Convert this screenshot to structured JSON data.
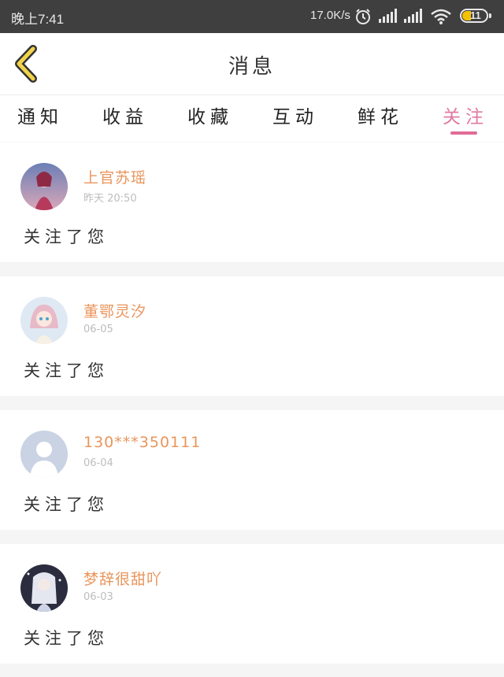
{
  "status_bar": {
    "time": "晚上7:41",
    "network_speed": "17.0K/s",
    "battery": "11",
    "icons": [
      "alarm-icon",
      "signal-icon",
      "signal-icon",
      "wifi-icon",
      "battery-icon"
    ]
  },
  "header": {
    "title": "消息",
    "back_icon": "chevron-left-icon"
  },
  "tabs": [
    {
      "label": "通知"
    },
    {
      "label": "收益"
    },
    {
      "label": "收藏"
    },
    {
      "label": "互动"
    },
    {
      "label": "鲜花"
    },
    {
      "label": "关注"
    }
  ],
  "active_tab": "关注",
  "messages": [
    {
      "username": "上官苏瑶",
      "time": "昨天 20:50",
      "text": "关注了您"
    },
    {
      "username": "董鄂灵汐",
      "time": "06-05",
      "text": "关注了您"
    },
    {
      "username": "130***350111",
      "time": "06-04",
      "text": "关注了您"
    },
    {
      "username": "梦辞很甜吖",
      "time": "06-03",
      "text": "关注了您"
    }
  ],
  "colors": {
    "accent": "#e06b96",
    "username": "#e9955c",
    "back_arrow": "#f0d34a",
    "status_bar_bg": "#3f3f3f"
  }
}
